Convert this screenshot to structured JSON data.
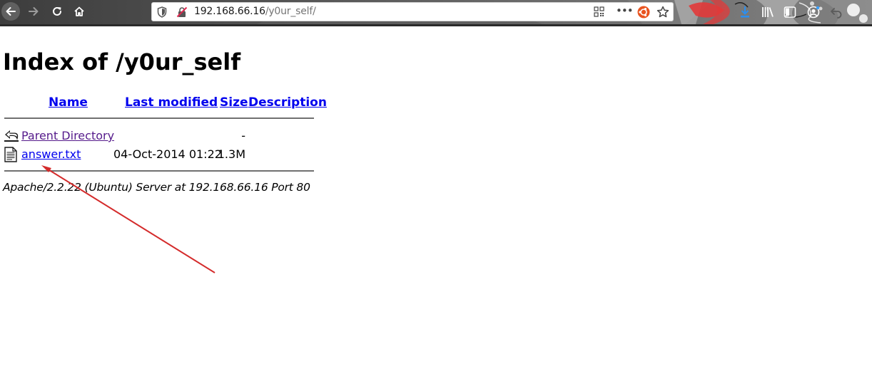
{
  "browser": {
    "url_host": "192.168.66.16",
    "url_path": "/y0ur_self/",
    "icons": [
      "back-icon",
      "forward-icon",
      "reload-icon",
      "home-icon",
      "tracking-shield-icon",
      "insecure-lock-icon",
      "qr-code-icon",
      "page-actions-icon",
      "ubuntu-icon",
      "bookmark-star-icon",
      "download-icon",
      "library-icon",
      "sidebar-icon",
      "account-icon",
      "undo-icon"
    ],
    "colors": {
      "toolbar": "#4a4a4a",
      "accent_red": "#e03030",
      "download_blue": "#1e90ff"
    }
  },
  "page": {
    "title": "Index of /y0ur_self",
    "columns": {
      "name": "Name",
      "last_modified": "Last modified",
      "size": "Size",
      "description": "Description"
    },
    "rows": [
      {
        "name": "Parent Directory",
        "last_modified": "",
        "size": "-",
        "icon": "back-folder-icon"
      },
      {
        "name": "answer.txt",
        "last_modified": "04-Oct-2014 01:22",
        "size": "1.3M",
        "icon": "text-file-icon"
      }
    ],
    "server_signature": "Apache/2.2.22 (Ubuntu) Server at 192.168.66.16 Port 80"
  },
  "annotation": {
    "type": "arrow",
    "color": "#d42b2b",
    "target": "answer.txt"
  }
}
